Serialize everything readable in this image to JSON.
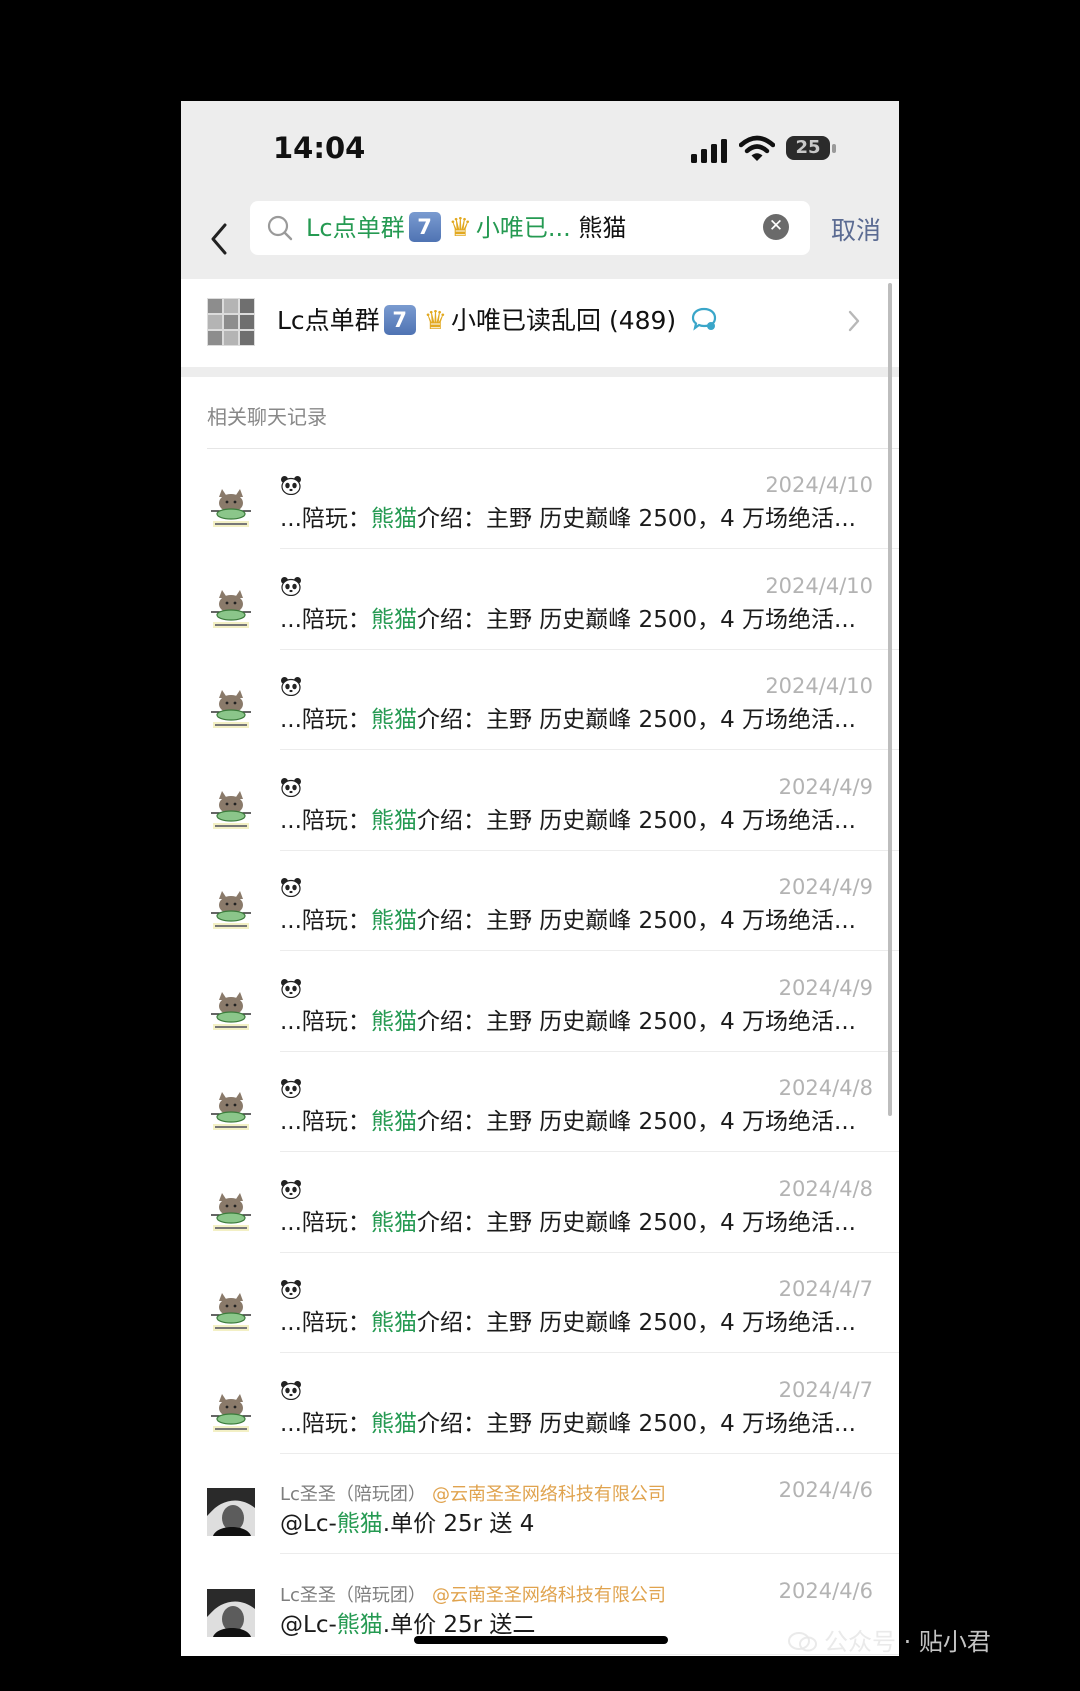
{
  "status_bar": {
    "time": "14:04",
    "battery": "25"
  },
  "search": {
    "query_prefix": "Lc点单群",
    "query_key": "7",
    "query_mid": "小唯已...",
    "query_keyword": "熊猫",
    "cancel_label": "取消"
  },
  "group": {
    "name_prefix": "Lc点单群",
    "name_key": "7",
    "name_suffix": "小唯已读乱回 (489)"
  },
  "section_title": "相关聊天记录",
  "messages": [
    {
      "date": "2024/4/10",
      "text_prefix": "...陪玩：",
      "keyword": "熊猫",
      "text_suffix": "介绍：主野 历史巅峰 2500，4 万场绝活..."
    },
    {
      "date": "2024/4/10",
      "text_prefix": "...陪玩：",
      "keyword": "熊猫",
      "text_suffix": "介绍：主野 历史巅峰 2500，4 万场绝活..."
    },
    {
      "date": "2024/4/10",
      "text_prefix": "...陪玩：",
      "keyword": "熊猫",
      "text_suffix": "介绍：主野 历史巅峰 2500，4 万场绝活..."
    },
    {
      "date": "2024/4/9",
      "text_prefix": "...陪玩：",
      "keyword": "熊猫",
      "text_suffix": "介绍：主野 历史巅峰 2500，4 万场绝活..."
    },
    {
      "date": "2024/4/9",
      "text_prefix": "...陪玩：",
      "keyword": "熊猫",
      "text_suffix": "介绍：主野 历史巅峰 2500，4 万场绝活..."
    },
    {
      "date": "2024/4/9",
      "text_prefix": "...陪玩：",
      "keyword": "熊猫",
      "text_suffix": "介绍：主野 历史巅峰 2500，4 万场绝活..."
    },
    {
      "date": "2024/4/8",
      "text_prefix": "...陪玩：",
      "keyword": "熊猫",
      "text_suffix": "介绍：主野 历史巅峰 2500，4 万场绝活..."
    },
    {
      "date": "2024/4/8",
      "text_prefix": "...陪玩：",
      "keyword": "熊猫",
      "text_suffix": "介绍：主野 历史巅峰 2500，4 万场绝活..."
    },
    {
      "date": "2024/4/7",
      "text_prefix": "...陪玩：",
      "keyword": "熊猫",
      "text_suffix": "介绍：主野 历史巅峰 2500，4 万场绝活..."
    },
    {
      "date": "2024/4/7",
      "text_prefix": "...陪玩：",
      "keyword": "熊猫",
      "text_suffix": "介绍：主野 历史巅峰 2500，4 万场绝活..."
    },
    {
      "date": "2024/4/6",
      "sender": "Lc圣圣（陪玩团）",
      "company": "@云南圣圣网络科技有限公司",
      "text_prefix": "@Lc-",
      "keyword": "熊猫",
      "text_suffix": ".单价 25r 送 4"
    },
    {
      "date": "2024/4/6",
      "sender": "Lc圣圣（陪玩团）",
      "company": "@云南圣圣网络科技有限公司",
      "text_prefix": "@Lc-",
      "keyword": "熊猫",
      "text_suffix": ".单价 25r 送二"
    }
  ],
  "watermark": "公众号 · 贴小君",
  "colors": {
    "keyword": "#259a52",
    "cancel": "#5b6b92",
    "company": "#e0a34e",
    "date": "#b3b3b3"
  }
}
